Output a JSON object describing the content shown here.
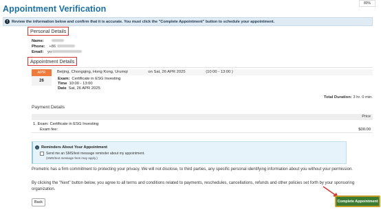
{
  "zoom_badge": "80%",
  "title": "Appointment Verification",
  "notice": "Review the information below and confirm that it is accurate. You must click the \"Complete Appointment\" button to schedule your appointment.",
  "personal": {
    "header": "Personal Details",
    "name_label": "Name:",
    "phone_label": "Phone:",
    "phone_prefix": "+86",
    "email_label": "Email:",
    "email_prefix": "yo"
  },
  "appointment": {
    "header": "Appointment Details",
    "month": "APR",
    "day": "26",
    "location": "Beijing, Chongqing, Hong Kong, Urumqi",
    "on_date": "on Sat, 26 APR 2025",
    "time_range": "(10:00 - 13:00 )",
    "exam_label": "Exam:",
    "exam_value": "Certificate in ESG Investing",
    "time_label": "Time",
    "time_value": "10:00 - 13:00",
    "date_label": "Date",
    "date_value": "Sat, 26 APR 2025",
    "total_label": "Total Duration:",
    "total_value": "3 hr. 0 min."
  },
  "payment": {
    "header": "Payment Details",
    "price_col": "Price",
    "item_line": "1. Exam: Certificate in ESG Investing",
    "fee_label": "Exam fee:",
    "fee_amount": "$00.00"
  },
  "reminder": {
    "title": "Reminders About Your Appointment",
    "checkbox_label": "Send me an SMS/text message reminder about my appointment.",
    "note": "(SMS/text message fees may apply.)"
  },
  "privacy_text": "Prometric has a firm commitment to protecting your privacy. We will not disclose, to third parties, any specific personal identifying information about you without your permission.",
  "terms_text": "By clicking the \"Next\" button below, you agree to all terms and conditions related to payments, reschedules, cancellations, refunds and other policies set forth by your sponsoring organization.",
  "buttons": {
    "back": "Back",
    "complete": "Complete Appointment"
  },
  "colors": {
    "title_blue": "#1a6fa8",
    "highlight_red": "#d9302b",
    "month_orange": "#f07a3a",
    "complete_green": "#3b7a31",
    "complete_border": "#c8a026"
  }
}
